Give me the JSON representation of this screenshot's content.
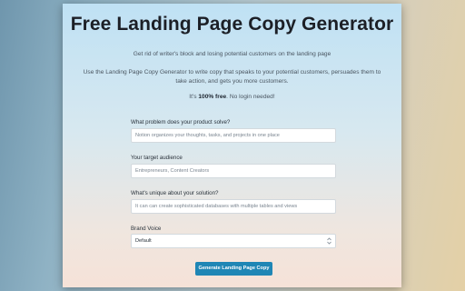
{
  "page": {
    "title": "Free Landing Page Copy Generator",
    "subtitle": "Get rid of writer's block and losing potential customers on the landing page",
    "description": "Use the Landing Page Copy Generator to write copy that speaks to your potential customers, persuades them to take action, and gets you more customers.",
    "free_prefix": "It's ",
    "free_bold": "100% free",
    "free_suffix": ". No login needed!"
  },
  "form": {
    "problem_label": "What problem does your product solve?",
    "problem_placeholder": "Notion organizes your thoughts, tasks, and projects in one place",
    "audience_label": "Your target audience",
    "audience_placeholder": "Entrepreneurs, Content Creators",
    "unique_label": "What's unique about your solution?",
    "unique_placeholder": "It can can create sophisticated databases with multiple tables and views",
    "voice_label": "Brand Voice",
    "voice_value": "Default",
    "submit_label": "Generate Landing Page Copy"
  },
  "colors": {
    "button": "#1f86b5",
    "title": "#1c1f26"
  },
  "icons": {
    "select_chevrons": "chevron-up-down-icon"
  }
}
